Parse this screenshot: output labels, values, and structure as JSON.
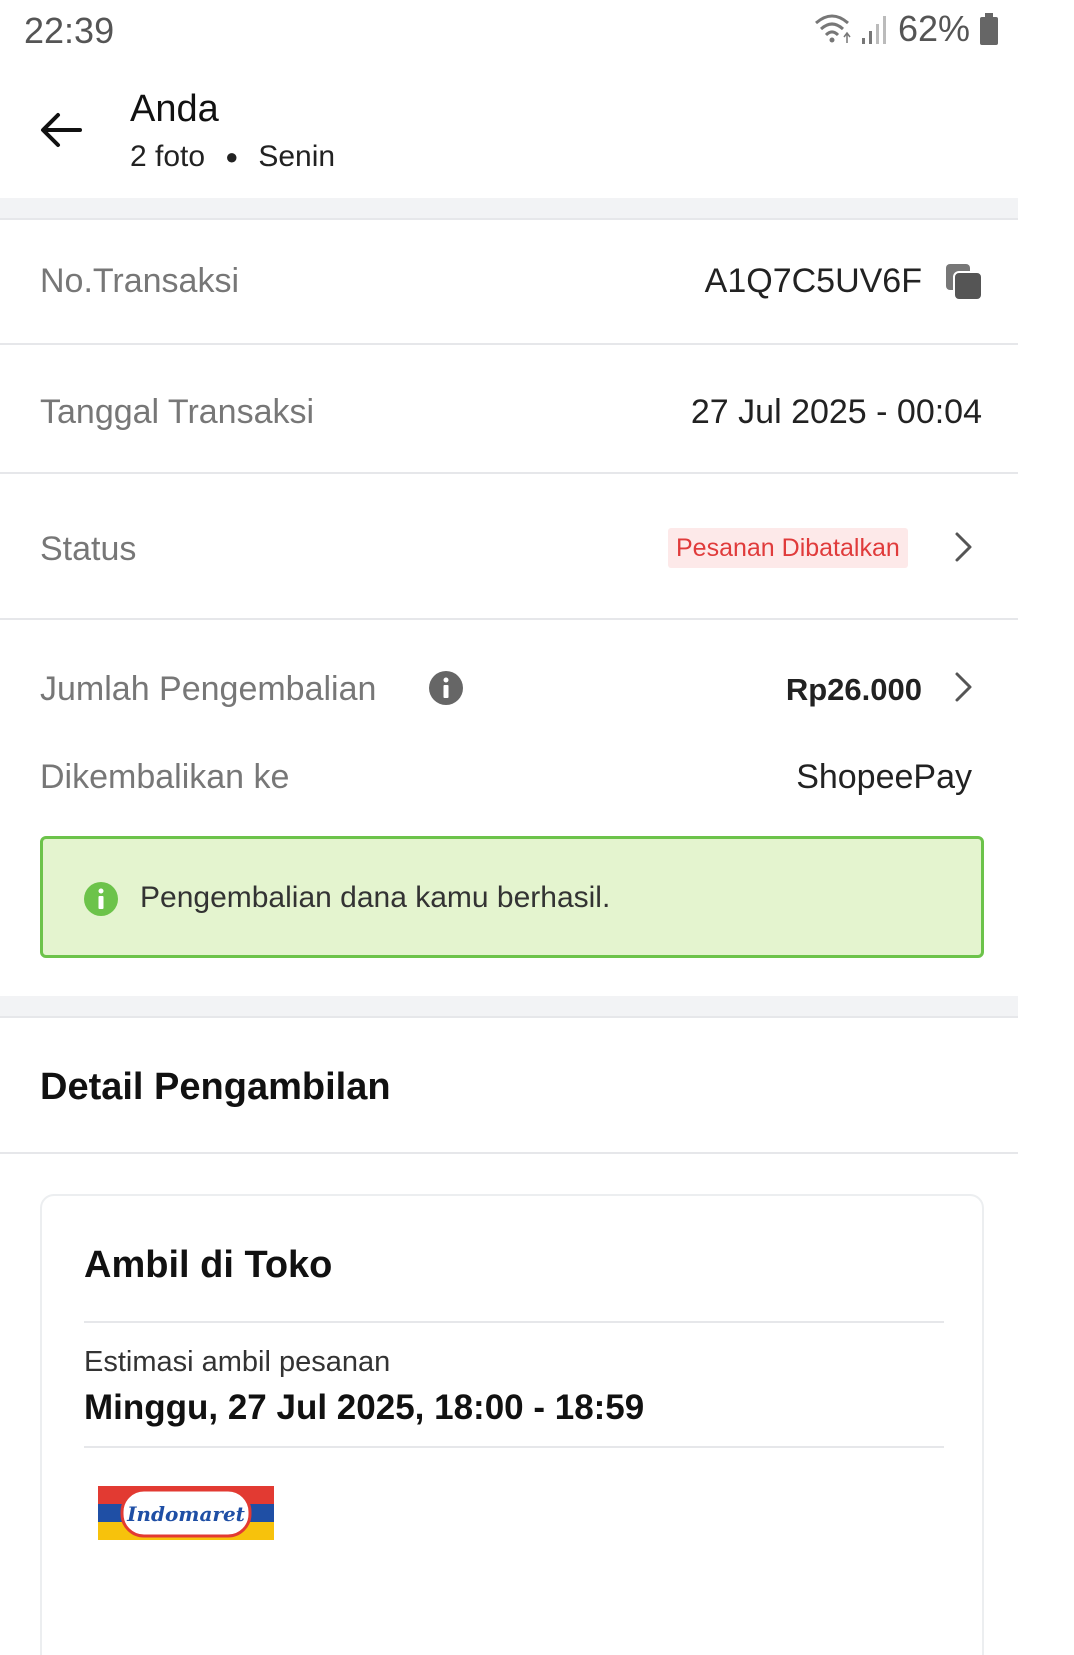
{
  "status_bar": {
    "time": "22:39",
    "battery_percent": "62%"
  },
  "header": {
    "title": "Anda",
    "photo_count": "2 foto",
    "day": "Senin"
  },
  "transaction": {
    "number_label": "No.Transaksi",
    "number_value": "A1Q7C5UV6F",
    "date_label": "Tanggal Transaksi",
    "date_value": "27 Jul 2025 - 00:04",
    "status_label": "Status",
    "status_value": "Pesanan Dibatalkan",
    "refund_label": "Jumlah Pengembalian",
    "refund_value": "Rp26.000",
    "refund_to_label": "Dikembalikan ke",
    "refund_to_value": "ShopeePay",
    "notice_text": "Pengembalian dana kamu berhasil."
  },
  "pickup": {
    "section_title": "Detail Pengambilan",
    "card_title": "Ambil di Toko",
    "estimate_label": "Estimasi ambil pesanan",
    "estimate_value": "Minggu, 27 Jul 2025, 18:00 - 18:59",
    "store_logo_text": "Indomaret"
  },
  "colors": {
    "status_red": "#e03b3b",
    "status_bg": "#fde9e9",
    "notice_green": "#6cc34a",
    "notice_bg": "#e4f4cf"
  },
  "icons": {
    "back": "arrow-left-icon",
    "copy": "copy-icon",
    "chevron": "chevron-right-icon",
    "info": "info-icon",
    "notice": "info-circle-green-icon",
    "wifi": "wifi-icon",
    "signal": "signal-icon",
    "battery": "battery-icon"
  }
}
